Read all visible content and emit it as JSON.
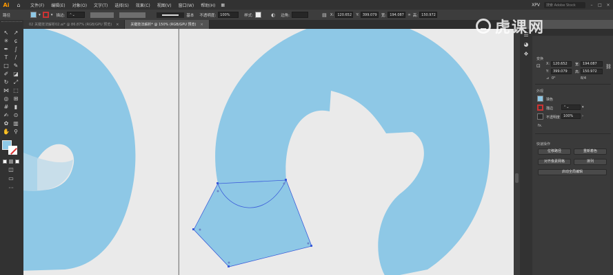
{
  "app": {
    "logo": "Ai",
    "workspace": "XPV"
  },
  "menu": [
    "文件(F)",
    "编辑(E)",
    "对象(O)",
    "文字(T)",
    "选择(S)",
    "效果(C)",
    "视图(V)",
    "窗口(W)",
    "帮助(H)"
  ],
  "search": {
    "placeholder": "搜索 Adobe Stock"
  },
  "control": {
    "selection": "路径",
    "stroke_label": "描边:",
    "stroke_style": "基本",
    "opacity_label": "不透明度:",
    "opacity": "100%",
    "style_label": "样式:",
    "angle_label": "边角:",
    "x_label": "X:",
    "x": "120.652",
    "y_label": "Y:",
    "y": "399.079",
    "w_label": "宽:",
    "w": "194.087",
    "h_label": "高:",
    "h": "150.972"
  },
  "tabs": [
    {
      "label": "02 关键技法解析02.ai* @ 86.87% (RGB/GPU 预览)",
      "close": "×"
    },
    {
      "label": "关键技法解析* @ 150% (RGB/GPU 预览)",
      "close": "×"
    }
  ],
  "props": {
    "transform_title": "变换",
    "x": "120.652",
    "w": "194.087",
    "y": "399.079",
    "h": "150.972",
    "angle": "0°",
    "appearance_title": "外观",
    "fill_label": "填色",
    "stroke_label": "描边",
    "opacity_label": "不透明度",
    "opacity": "100%",
    "fx": "fx.",
    "quick_title": "快速操作",
    "btn_offset": "位移路径",
    "btn_recolor": "重新着色",
    "btn_align": "对齐像素网格",
    "btn_arrange": "排列",
    "btn_global_edit": "启动全局编辑",
    "ratio": "8/4"
  },
  "watermark": "虎课网",
  "colors": {
    "shape_fill": "#8ec8e6",
    "selection": "#3a5bd9",
    "canvas": "#eaeaea",
    "accent": "#ff9a00"
  }
}
